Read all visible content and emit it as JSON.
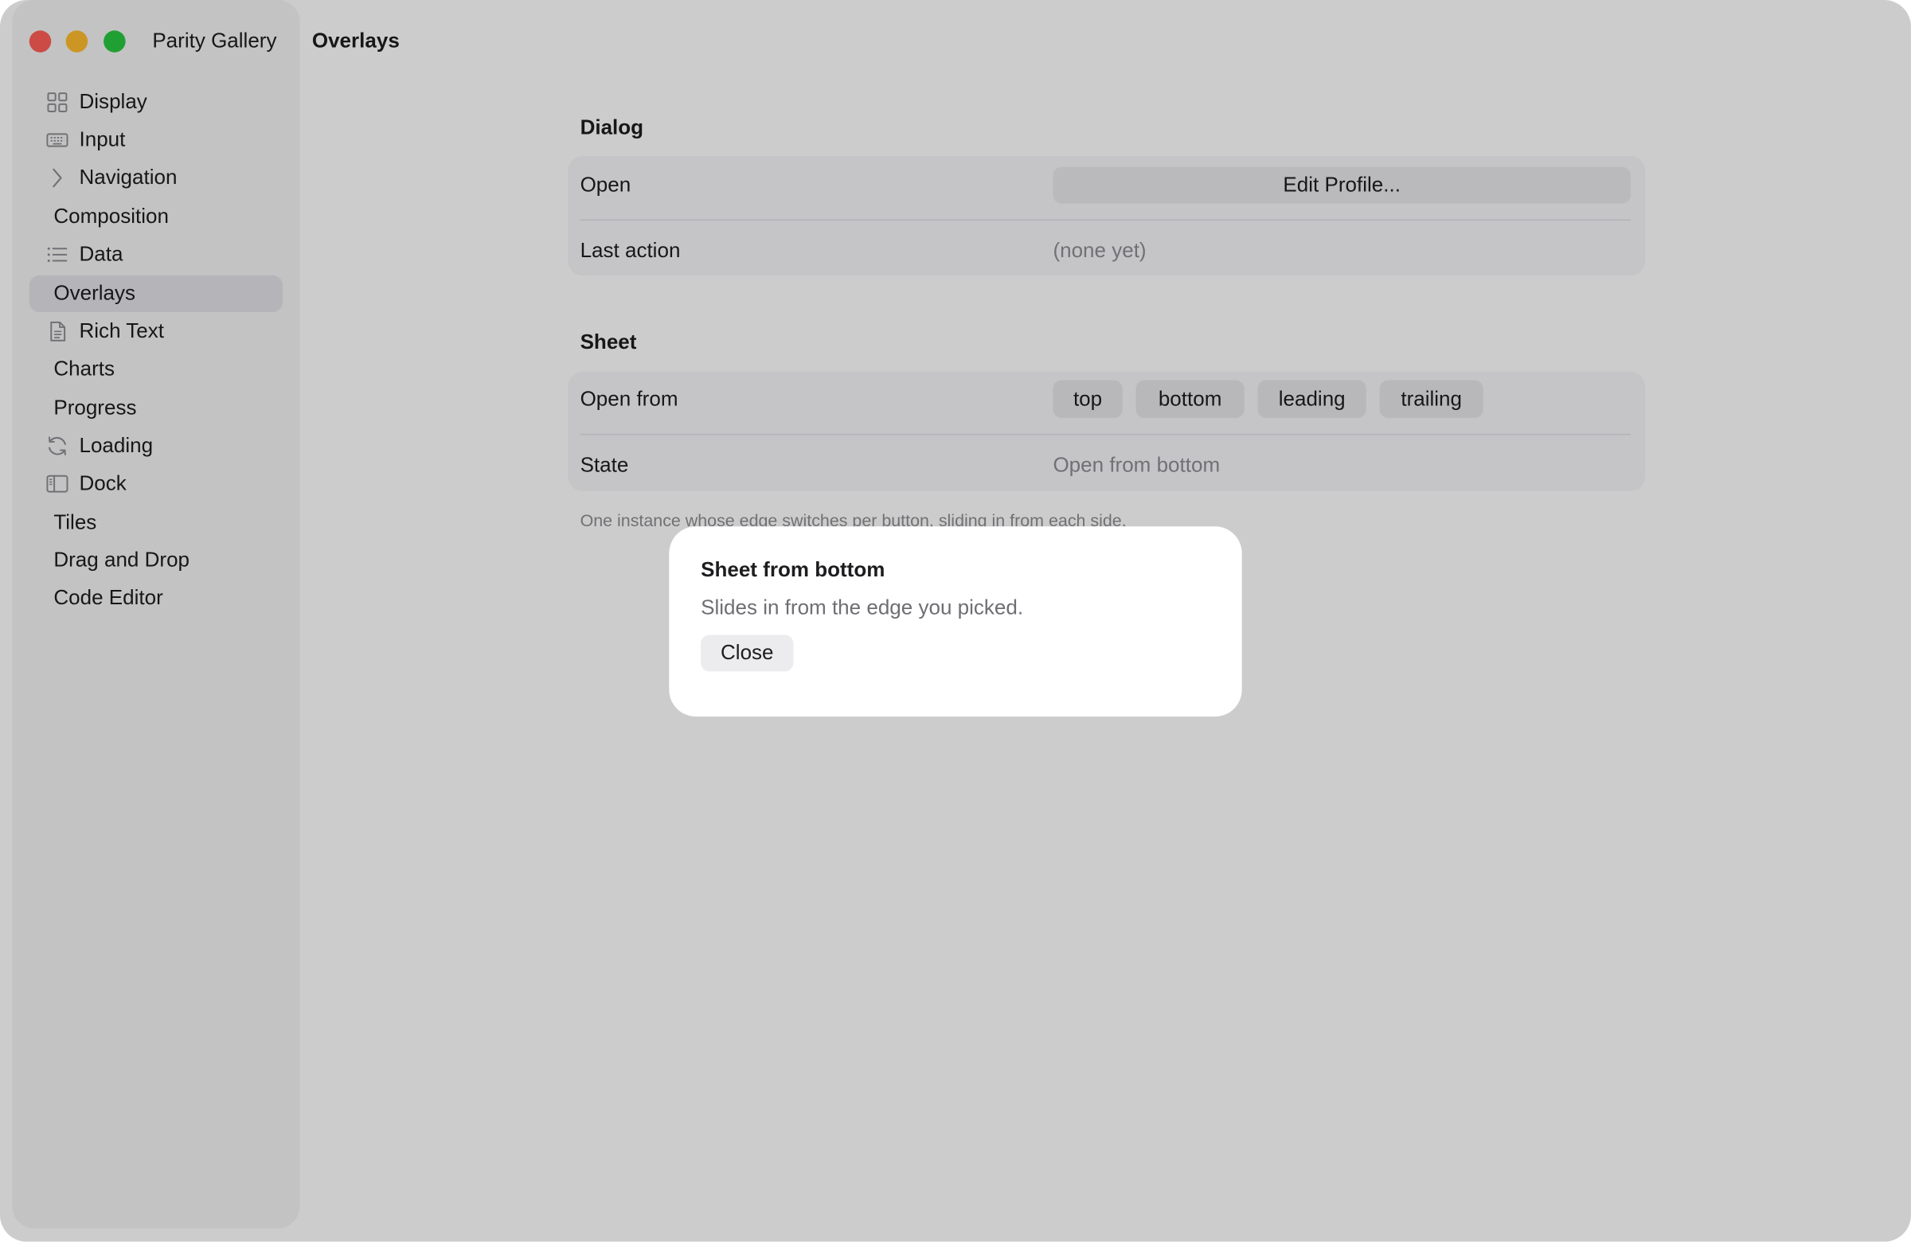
{
  "window": {
    "app_title": "Parity Gallery",
    "page_title": "Overlays"
  },
  "sidebar": {
    "items": [
      {
        "label": "Display",
        "icon": "grid-icon"
      },
      {
        "label": "Input",
        "icon": "keyboard-icon"
      },
      {
        "label": "Navigation",
        "icon": "chevron-right-icon"
      },
      {
        "label": "Composition",
        "icon": ""
      },
      {
        "label": "Data",
        "icon": "list-icon"
      },
      {
        "label": "Overlays",
        "icon": "",
        "selected": true
      },
      {
        "label": "Rich Text",
        "icon": "document-icon"
      },
      {
        "label": "Charts",
        "icon": ""
      },
      {
        "label": "Progress",
        "icon": ""
      },
      {
        "label": "Loading",
        "icon": "refresh-icon"
      },
      {
        "label": "Dock",
        "icon": "sidebar-panel-icon"
      },
      {
        "label": "Tiles",
        "icon": ""
      },
      {
        "label": "Drag and Drop",
        "icon": ""
      },
      {
        "label": "Code Editor",
        "icon": ""
      }
    ]
  },
  "dialog_section": {
    "title": "Dialog",
    "open_label": "Open",
    "open_button": "Edit Profile...",
    "last_action_label": "Last action",
    "last_action_value": "(none yet)"
  },
  "sheet_section": {
    "title": "Sheet",
    "open_from_label": "Open from",
    "edges": [
      "top",
      "bottom",
      "leading",
      "trailing"
    ],
    "state_label": "State",
    "state_value": "Open from bottom",
    "footnote": "One instance whose edge switches per button, sliding in from each side."
  },
  "sheet": {
    "title": "Sheet from bottom",
    "message": "Slides in from the edge you picked.",
    "close_label": "Close"
  },
  "colors": {
    "close": "#ff5f57",
    "minimize": "#febc2e",
    "zoom": "#28c840",
    "scrim": "rgba(0,0,0,0.2)"
  }
}
